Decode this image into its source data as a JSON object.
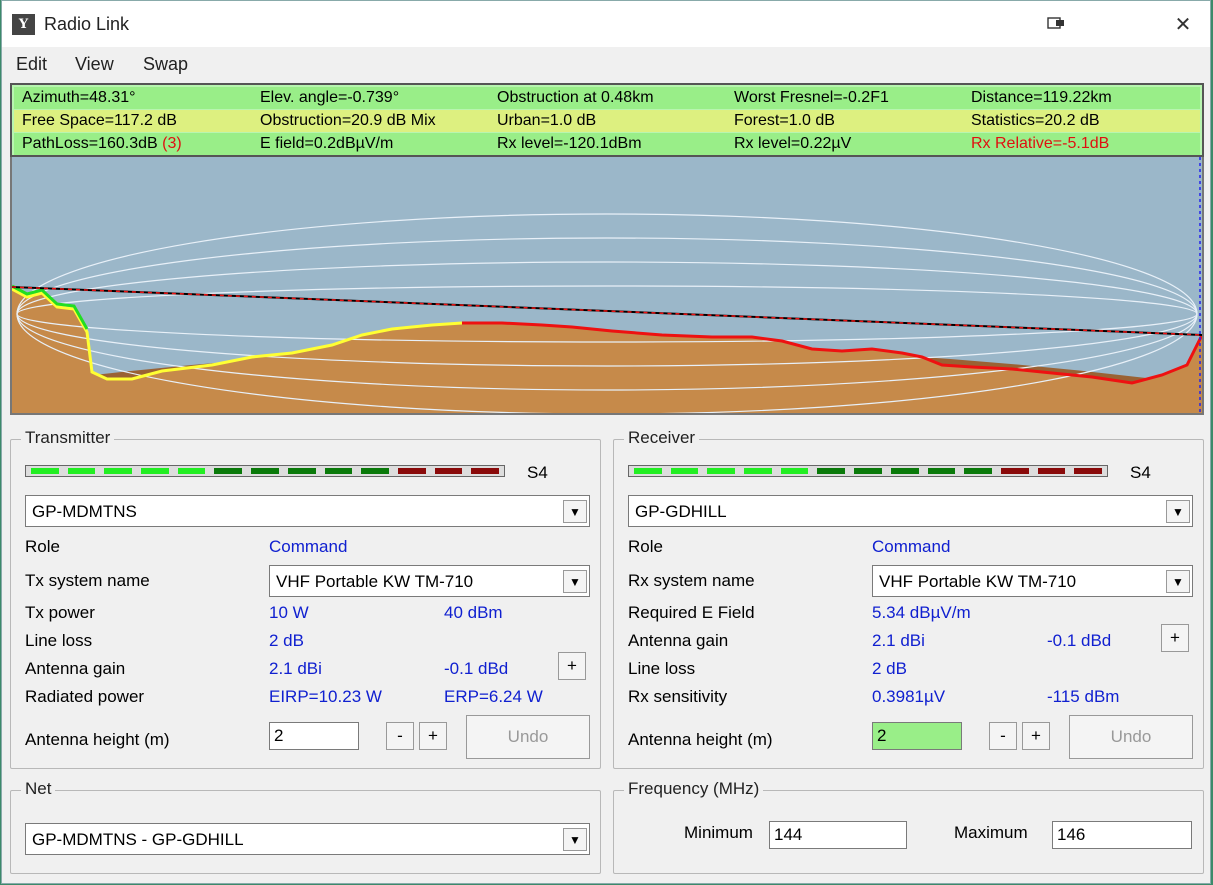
{
  "window": {
    "title": "Radio Link",
    "icon": "antenna-app-icon"
  },
  "menu": [
    "Edit",
    "View",
    "Swap"
  ],
  "info": {
    "row1": [
      "Azimuth=48.31°",
      "Elev. angle=-0.739°",
      "Obstruction at 0.48km",
      "Worst Fresnel=-0.2F1",
      "Distance=119.22km"
    ],
    "row2": [
      "Free Space=117.2 dB",
      "Obstruction=20.9 dB Mix",
      "Urban=1.0 dB",
      "Forest=1.0 dB",
      "Statistics=20.2 dB"
    ],
    "row3_pathloss": "PathLoss=160.3dB",
    "row3_pathloss_flag": "(3)",
    "row3": [
      "E field=0.2dBµV/m",
      "Rx level=-120.1dBm",
      "Rx level=0.22µV",
      "Rx Relative=-5.1dB"
    ]
  },
  "transmitter": {
    "label": "Transmitter",
    "meter_label": "S4",
    "station": "GP-MDMTNS",
    "role_label": "Role",
    "role": "Command",
    "system_label": "Tx system name",
    "system": "VHF Portable KW TM-710",
    "power_label": "Tx power",
    "power_w": "10 W",
    "power_dbm": "40 dBm",
    "lineloss_label": "Line loss",
    "lineloss": "2 dB",
    "gain_label": "Antenna gain",
    "gain_dbi": "2.1 dBi",
    "gain_dbd": "-0.1 dBd",
    "radiated_label": "Radiated power",
    "eirp": "EIRP=10.23 W",
    "erp": "ERP=6.24 W",
    "height_label": "Antenna height (m)",
    "height": "2",
    "plus": "+",
    "minus": "-",
    "undo": "Undo"
  },
  "receiver": {
    "label": "Receiver",
    "meter_label": "S4",
    "station": "GP-GDHILL",
    "role_label": "Role",
    "role": "Command",
    "system_label": "Rx system name",
    "system": "VHF Portable KW TM-710",
    "efield_label": "Required E Field",
    "efield": "5.34 dBµV/m",
    "gain_label": "Antenna gain",
    "gain_dbi": "2.1 dBi",
    "gain_dbd": "-0.1 dBd",
    "lineloss_label": "Line loss",
    "lineloss": "2 dB",
    "sens_label": "Rx sensitivity",
    "sens_uv": "0.3981µV",
    "sens_dbm": "-115 dBm",
    "height_label": "Antenna height (m)",
    "height": "2",
    "plus": "+",
    "minus": "-",
    "undo": "Undo"
  },
  "net": {
    "label": "Net",
    "value": "GP-MDMTNS - GP-GDHILL"
  },
  "frequency": {
    "label": "Frequency (MHz)",
    "min_label": "Minimum",
    "min": "144",
    "max_label": "Maximum",
    "max": "146"
  },
  "colors": {
    "sky": "#9bb7c9",
    "terrain": "#c68a4a",
    "path_red": "#ee1111",
    "good_green": "#22ee22",
    "info_green": "#99ee88"
  }
}
